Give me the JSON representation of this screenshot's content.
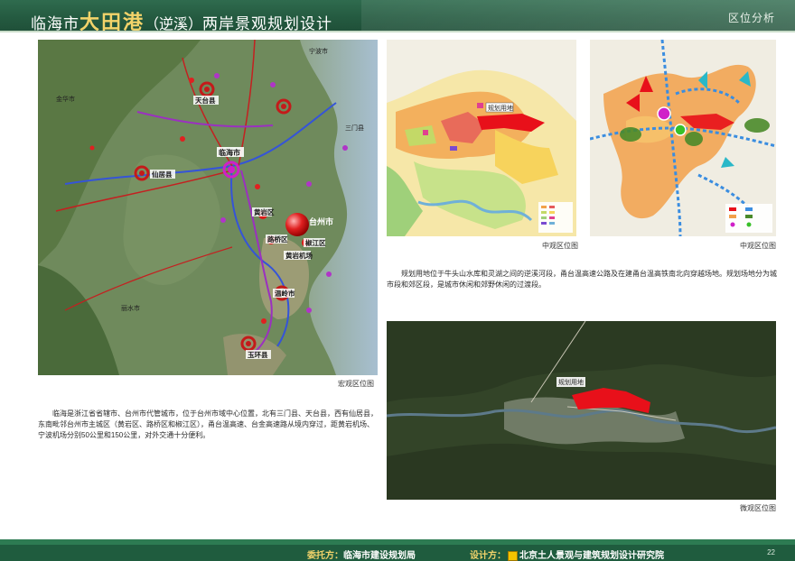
{
  "header": {
    "title_part1": "临海市",
    "title_emph": "大田港",
    "title_paren": "（逆溪）",
    "title_part2": "两岸景观规划设计",
    "section": "区位分析"
  },
  "macro_map": {
    "caption": "宏观区位图",
    "places": {
      "ningbo": "宁波市",
      "jinhua": "金华市",
      "tiantai": "天台县",
      "sanmen": "三门县",
      "linhai": "临海市",
      "xianju": "仙居县",
      "huangyan": "黄岩区",
      "taizhou": "台州市",
      "luqiao": "路桥区",
      "jiaojiang": "椒江区",
      "airport": "黄岩机场",
      "wenling": "温岭市",
      "yuhuan": "玉环县",
      "lishui": "丽水市"
    }
  },
  "meso_map_left": {
    "caption": "中观区位图",
    "site_label": "规划用地"
  },
  "meso_map_right": {
    "caption": "中观区位图"
  },
  "micro_map": {
    "caption": "微观区位图",
    "site_label": "规划用地"
  },
  "texts": {
    "macro_desc": "临海是浙江省省辖市、台州市代管城市，位于台州市域中心位置，北有三门县、天台县，西有仙居县，东南毗邻台州市主城区（黄岩区、路桥区和椒江区），甬台温高速、台金高速路从境内穿过，距黄岩机场、宁波机场分别50公里和150公里，对外交通十分便利。",
    "site_desc": "规划用地位于牛头山水库和灵湖之间的逆溪河段，甬台温高速公路及在建甬台温高铁南北向穿越场地。规划场地分为城市段和郊区段，是城市休闲和郊野休闲的过渡段。"
  },
  "footer": {
    "client_label": "委托方：",
    "client": "临海市建设规划局",
    "designer_label": "设计方：",
    "designer": "北京土人景观与建筑规划设计研究院",
    "page": "22"
  },
  "colors": {
    "header_green": "#245a40",
    "title_accent": "#f3d36a",
    "site_red": "#e8101a",
    "footer_green": "#1f5c3e"
  }
}
